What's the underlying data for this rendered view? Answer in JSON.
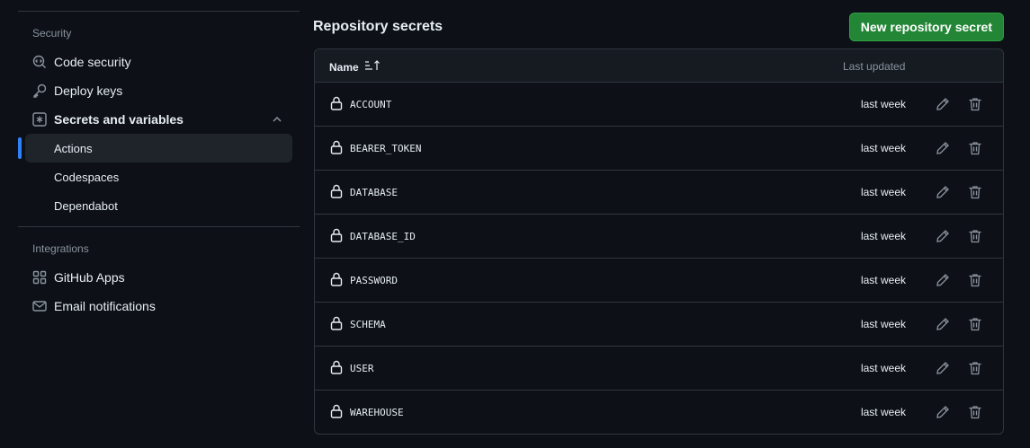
{
  "sidebar": {
    "security_label": "Security",
    "security_items": [
      {
        "label": "Code security",
        "icon": "code-security-icon"
      },
      {
        "label": "Deploy keys",
        "icon": "key-icon"
      },
      {
        "label": "Secrets and variables",
        "icon": "asterisk-box-icon"
      }
    ],
    "secrets_subitems": [
      {
        "label": "Actions",
        "active": true
      },
      {
        "label": "Codespaces",
        "active": false
      },
      {
        "label": "Dependabot",
        "active": false
      }
    ],
    "integrations_label": "Integrations",
    "integration_items": [
      {
        "label": "GitHub Apps",
        "icon": "apps-grid-icon"
      },
      {
        "label": "Email notifications",
        "icon": "mail-icon"
      }
    ]
  },
  "main": {
    "title": "Repository secrets",
    "new_button_label": "New repository secret",
    "table": {
      "col_name": "Name",
      "col_updated": "Last updated",
      "rows": [
        {
          "name": "ACCOUNT",
          "updated": "last week"
        },
        {
          "name": "BEARER_TOKEN",
          "updated": "last week"
        },
        {
          "name": "DATABASE",
          "updated": "last week"
        },
        {
          "name": "DATABASE_ID",
          "updated": "last week"
        },
        {
          "name": "PASSWORD",
          "updated": "last week"
        },
        {
          "name": "SCHEMA",
          "updated": "last week"
        },
        {
          "name": "USER",
          "updated": "last week"
        },
        {
          "name": "WAREHOUSE",
          "updated": "last week"
        }
      ]
    }
  },
  "colors": {
    "background": "#0d1117",
    "accent_blue": "#2f81f7",
    "button_green": "#238636",
    "border": "#30363d"
  }
}
